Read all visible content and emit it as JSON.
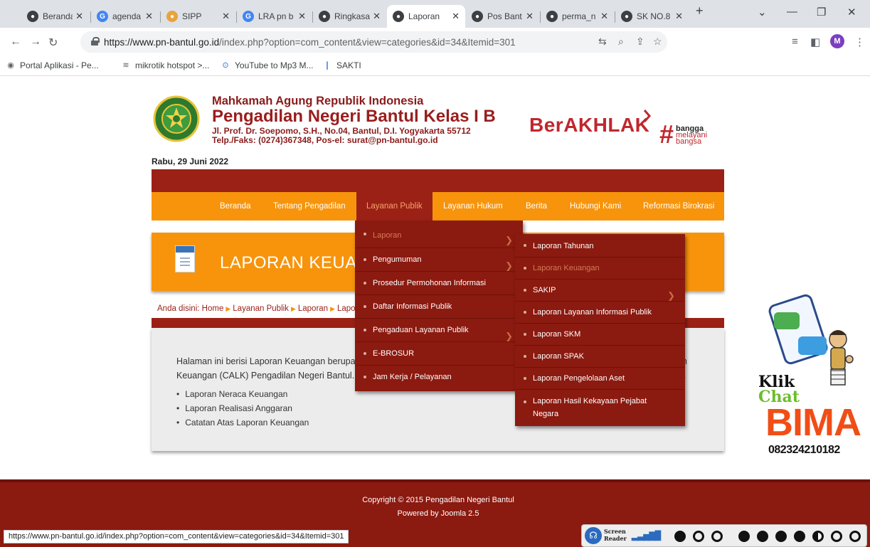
{
  "browser": {
    "tabs": [
      {
        "title": "Beranda",
        "icon": "globe-icon",
        "color": "#3c4043"
      },
      {
        "title": "agenda s",
        "icon": "google-icon",
        "color": "#4285f4"
      },
      {
        "title": "SIPP",
        "icon": "sipp-icon",
        "color": "#e8a33d"
      },
      {
        "title": "LRA pn b",
        "icon": "google-icon",
        "color": "#4285f4"
      },
      {
        "title": "Ringkasa",
        "icon": "globe-icon",
        "color": "#3c4043"
      },
      {
        "title": "Laporan",
        "icon": "globe-icon",
        "color": "#3c4043"
      },
      {
        "title": "Pos Bant",
        "icon": "globe-icon",
        "color": "#3c4043"
      },
      {
        "title": "perma_n",
        "icon": "globe-icon",
        "color": "#3c4043"
      },
      {
        "title": "SK NO.8",
        "icon": "globe-icon",
        "color": "#3c4043"
      }
    ],
    "active_tab": 5,
    "new_tab": "+",
    "url_host": "https://www.pn-bantul.go.id",
    "url_path": "/index.php?option=com_content&view=categories&id=34&Itemid=301",
    "bookmarks": [
      {
        "label": "Portal Aplikasi - Pe...",
        "icon": "globe-icon"
      },
      {
        "label": "mikrotik hotspot >...",
        "icon": "wifi-icon"
      },
      {
        "label": "YouTube to Mp3 M...",
        "icon": "download-icon"
      },
      {
        "label": "SAKTI",
        "icon": "sakti-icon"
      }
    ],
    "status_url": "https://www.pn-bantul.go.id/index.php?option=com_content&view=categories&id=34&Itemid=301",
    "avatar_letter": "M"
  },
  "header": {
    "org_super": "Mahkamah Agung Republik Indonesia",
    "org_title": "Pengadilan Negeri Bantul Kelas I B",
    "address": "Jl. Prof. Dr. Soepomo, S.H., No.04, Bantul, D.I. Yogyakarta 55712",
    "contact": "Telp./Faks: (0274)367348, Pos-el: surat@pn-bantul.go.id",
    "berakhlak": "BerAKHLAK",
    "tagline": [
      "bangga",
      "melayani",
      "bangsa"
    ],
    "date": "Rabu, 29 Juni 2022"
  },
  "nav": {
    "items": [
      "Beranda",
      "Tentang Pengadilan",
      "Layanan Publik",
      "Layanan Hukum",
      "Berita",
      "Hubungi Kami",
      "Reformasi Birokrasi"
    ],
    "active": "Layanan Publik"
  },
  "dropdown_main": {
    "items": [
      {
        "label": "Laporan",
        "has_sub": true,
        "highlighted": true
      },
      {
        "label": "Pengumuman",
        "has_sub": true,
        "highlighted": false
      },
      {
        "label": "Prosedur Permohonan Informasi",
        "has_sub": false,
        "highlighted": false
      },
      {
        "label": "Daftar Informasi Publik",
        "has_sub": false,
        "highlighted": false
      },
      {
        "label": "Pengaduan Layanan Publik",
        "has_sub": true,
        "highlighted": false
      },
      {
        "label": "E-BROSUR",
        "has_sub": false,
        "highlighted": false
      },
      {
        "label": "Jam Kerja / Pelayanan",
        "has_sub": false,
        "highlighted": false
      }
    ]
  },
  "dropdown_sub": {
    "items": [
      {
        "label": "Laporan Tahunan",
        "has_sub": false,
        "highlighted": false
      },
      {
        "label": "Laporan Keuangan",
        "has_sub": false,
        "highlighted": true
      },
      {
        "label": "SAKIP",
        "has_sub": true,
        "highlighted": false
      },
      {
        "label": "Laporan Layanan Informasi Publik",
        "has_sub": false,
        "highlighted": false
      },
      {
        "label": "Laporan SKM",
        "has_sub": false,
        "highlighted": false
      },
      {
        "label": "Laporan SPAK",
        "has_sub": false,
        "highlighted": false
      },
      {
        "label": "Laporan Pengelolaan Aset",
        "has_sub": false,
        "highlighted": false
      },
      {
        "label": "Laporan Hasil Kekayaan Pejabat Negara",
        "has_sub": false,
        "highlighted": false
      }
    ]
  },
  "banner": {
    "title": "LAPORAN KEUANGAN"
  },
  "breadcrumb": {
    "prefix": "Anda disini:",
    "items": [
      "Home",
      "Layanan Publik",
      "Laporan",
      "Laporan Keuangan"
    ]
  },
  "content": {
    "paragraph": "Halaman ini berisi Laporan Keuangan berupa Laporan Neraca Keuangan, Laporan Realisasi Anggaran dan Catatan Atas Laporan Keuangan (CALK) Pengadilan Negeri Bantul. Untuk lebih lengkapnya silahkan pilih menu di bawah untuk memilih rincian laporan.",
    "bullets": [
      "Laporan Neraca Keuangan",
      "Laporan Realisasi Anggaran",
      "Catatan Atas Laporan Keuangan"
    ]
  },
  "chat_widget": {
    "klik": "Klik",
    "chat": "Chat",
    "name": "BIMA",
    "phone": "082324210182"
  },
  "footer": {
    "copyright": "Copyright © 2015 Pengadilan Negeri Bantul",
    "powered": "Powered by Joomla 2.5"
  },
  "accessibility": {
    "label_line1": "Screen",
    "label_line2": "Reader"
  },
  "colors": {
    "brand_red": "#9b2116",
    "menu_orange": "#f7940b",
    "berakhlak_red": "#c0272d"
  }
}
